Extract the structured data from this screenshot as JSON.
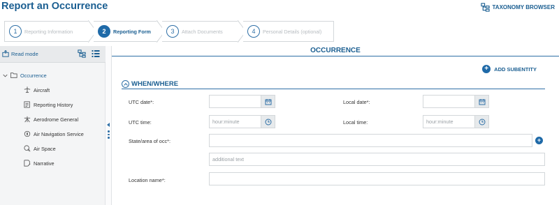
{
  "header": {
    "title": "Report an Occurrence",
    "taxonomy_label": "TAXONOMY BROWSER"
  },
  "steps": [
    {
      "number": "1",
      "label": "Reporting Information",
      "active": false
    },
    {
      "number": "2",
      "label": "Reporting Form",
      "active": true
    },
    {
      "number": "3",
      "label": "Attach Documents",
      "active": false
    },
    {
      "number": "4",
      "label": "Personal Details (optional)",
      "active": false
    }
  ],
  "sidebar": {
    "read_mode_label": "Read mode",
    "root_label": "Occurrence",
    "items": [
      {
        "label": "Aircraft",
        "icon": "aircraft-icon"
      },
      {
        "label": "Reporting History",
        "icon": "history-icon"
      },
      {
        "label": "Aerodrome General",
        "icon": "aerodrome-icon"
      },
      {
        "label": "Air Navigation Service",
        "icon": "navigation-icon"
      },
      {
        "label": "Air Space",
        "icon": "airspace-icon"
      },
      {
        "label": "Narrative",
        "icon": "narrative-icon"
      }
    ]
  },
  "main": {
    "title": "OCCURRENCE",
    "add_subentity_label": "ADD SUBENTITY",
    "section_title": "WHEN/WHERE",
    "fields": {
      "utc_date_label": "UTC date*:",
      "local_date_label": "Local date*:",
      "utc_time_label": "UTC time:",
      "local_time_label": "Local time:",
      "time_placeholder": "hour:minute",
      "state_area_label": "State/area of occ*:",
      "additional_text_placeholder": "additional text",
      "location_name_label": "Location name*:"
    }
  },
  "colors": {
    "accent": "#1a5e91",
    "accent_fill": "#1f6aa8",
    "border": "#d3d7da",
    "sidebar_bg": "#f4f5f6"
  }
}
